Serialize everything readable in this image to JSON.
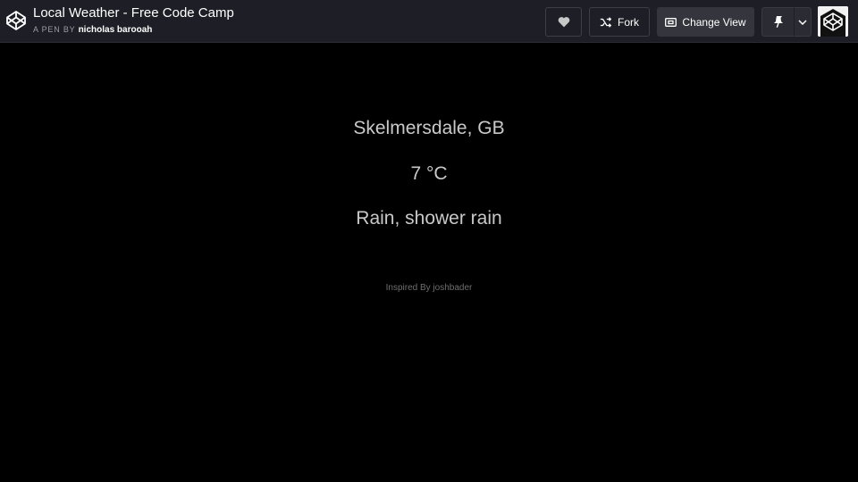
{
  "header": {
    "logo_icon": "codepen-logo-icon",
    "title": "Local Weather - Free Code Camp",
    "byline_prefix": "A PEN BY",
    "author": "nicholas barooah",
    "buttons": {
      "heart_icon": "heart-icon",
      "fork_label": "Fork",
      "fork_icon": "fork-icon",
      "change_view_label": "Change View",
      "change_view_icon": "view-icon",
      "pin_icon": "pin-icon",
      "dropdown_icon": "chevron-down-icon"
    },
    "avatar_icon": "codepen-avatar-icon"
  },
  "weather": {
    "location": "Skelmersdale, GB",
    "temperature": "7 °C",
    "condition": "Rain, shower rain",
    "credit": "Inspired By joshbader"
  },
  "colors": {
    "topbar_bg": "#1e1f26",
    "page_bg": "#000000",
    "weather_text": "#c9c9c9",
    "credit_text": "#6f6f6f"
  }
}
